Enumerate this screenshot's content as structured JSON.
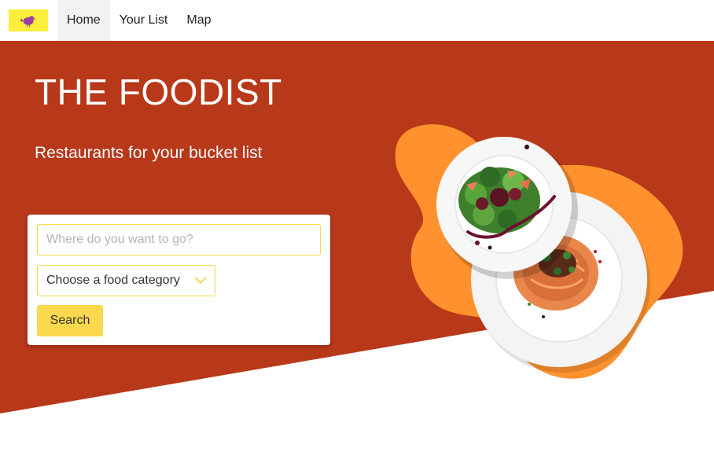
{
  "navbar": {
    "logo_icon": "bird-logo-icon",
    "items": [
      {
        "label": "Home",
        "active": true
      },
      {
        "label": "Your List",
        "active": false
      },
      {
        "label": "Map",
        "active": false
      }
    ]
  },
  "hero": {
    "title": "THE FOODIST",
    "subtitle": "Restaurants for your bucket list",
    "image": "food-plates-image"
  },
  "search": {
    "placeholder": "Where do you want to go?",
    "category_label": "Choose a food category",
    "button_label": "Search"
  },
  "colors": {
    "hero_bg": "#b8381a",
    "blob": "#ff922e",
    "accent_yellow": "#fcd94c",
    "logo_bg": "#fcee3a",
    "logo_bird": "#9b3fa6"
  }
}
